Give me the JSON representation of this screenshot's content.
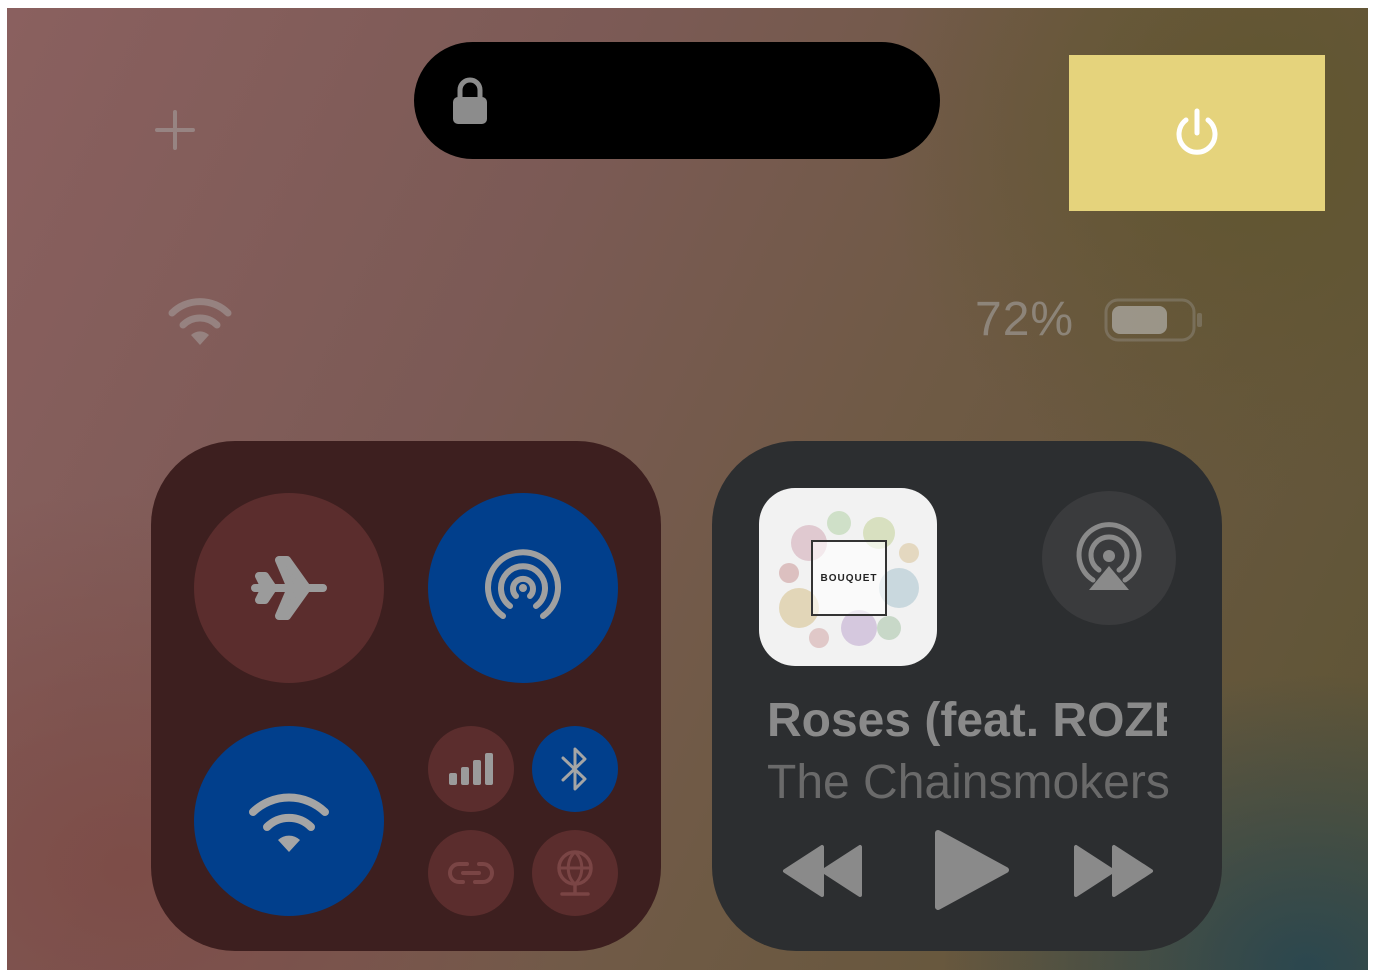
{
  "status_bar": {
    "battery_percent": "72%",
    "battery_level": 0.72,
    "wifi_icon": "wifi-icon"
  },
  "top_controls": {
    "add_icon": "plus-icon",
    "lock_icon": "lock-icon",
    "power_icon": "power-icon"
  },
  "connectivity": {
    "airplane_mode": {
      "icon": "airplane-icon",
      "on": false
    },
    "airdrop": {
      "icon": "airdrop-icon",
      "on": true
    },
    "wifi": {
      "icon": "wifi-icon",
      "on": true
    },
    "cellular": {
      "icon": "cellular-signal-icon",
      "on": false
    },
    "bluetooth": {
      "icon": "bluetooth-icon",
      "on": true
    },
    "personal_hotspot": {
      "icon": "hotspot-icon",
      "on": false
    },
    "vpn": {
      "icon": "vpn-globe-icon",
      "on": false
    }
  },
  "now_playing": {
    "album_text": "BOUQUET",
    "title": "Roses (feat. ROZES)",
    "artist": "The Chainsmokers",
    "airplay_icon": "airplay-audio-icon"
  },
  "colors": {
    "highlight": "#e5d37c",
    "active_blue": "#013f8c",
    "inactive_red": "#5b2d2d"
  }
}
